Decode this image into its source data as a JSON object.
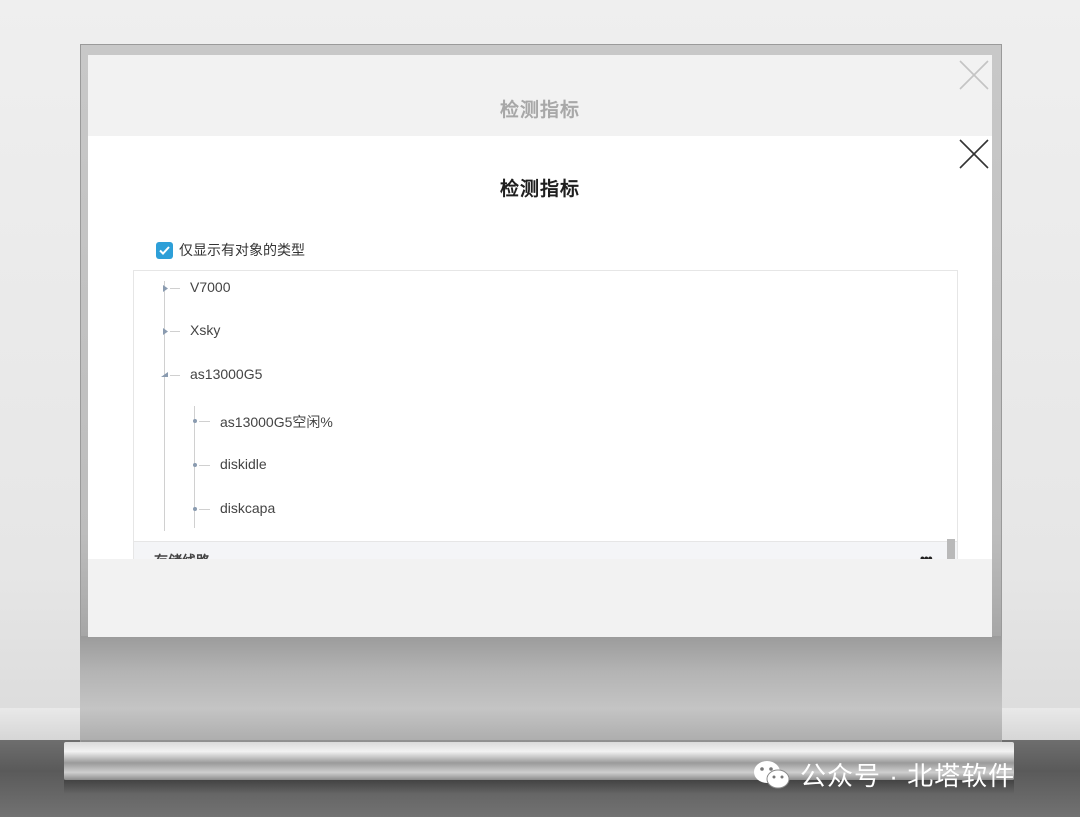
{
  "background_dialog": {
    "title": "检测指标"
  },
  "dialog": {
    "title": "检测指标",
    "filter": {
      "checked": true,
      "label": "仅显示有对象的类型"
    },
    "tree": {
      "nodes": [
        {
          "label": "V7000",
          "expanded": false
        },
        {
          "label": "Xsky",
          "expanded": false
        },
        {
          "label": "as13000G5",
          "expanded": true,
          "children": [
            {
              "label": "as13000G5空闲%"
            },
            {
              "label": "diskidle"
            },
            {
              "label": "diskcapa"
            }
          ]
        }
      ],
      "footer_group_label": "存储线路",
      "footer_more": "•••"
    }
  },
  "watermark": {
    "text": "公众号 · 北塔软件",
    "icon": "wechat-icon"
  },
  "colors": {
    "checkbox": "#2d9fd8",
    "screen_bg": "#f2f2f2"
  }
}
